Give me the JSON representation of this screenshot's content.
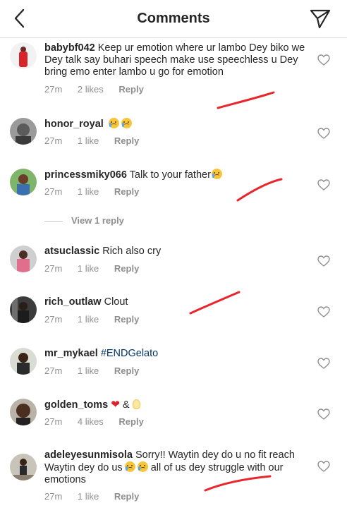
{
  "header": {
    "title": "Comments",
    "back_icon": "chevron-left-icon",
    "send_icon": "paper-plane-icon"
  },
  "comments": [
    {
      "username": "babybf042",
      "text": "Keep ur emotion where ur lambo Dey biko we Dey talk say buhari speech make use speechless u Dey bring emo enter lambo u go for emotion",
      "time": "27m",
      "likes": "2 likes",
      "reply": "Reply"
    },
    {
      "username": "honor_royal",
      "text": "",
      "emoji": [
        "crying-face",
        "crying-face"
      ],
      "time": "27m",
      "likes": "1 like",
      "reply": "Reply"
    },
    {
      "username": "princessmiky066",
      "text": "Talk to your father",
      "emoji": [
        "crying-face"
      ],
      "time": "27m",
      "likes": "1 like",
      "reply": "Reply"
    },
    {
      "username": "atsuclassic",
      "text": "Rich also cry",
      "time": "27m",
      "likes": "1 like",
      "reply": "Reply"
    },
    {
      "username": "rich_outlaw",
      "text": "Clout",
      "time": "27m",
      "likes": "1 like",
      "reply": "Reply"
    },
    {
      "username": "mr_mykael",
      "text": "#ENDGelato",
      "time": "27m",
      "likes": "1 like",
      "reply": "Reply"
    },
    {
      "username": "golden_toms",
      "text": "&",
      "emoji": [
        "red-heart",
        "light-bulb"
      ],
      "time": "27m",
      "likes": "4 likes",
      "reply": "Reply"
    },
    {
      "username": "adeleyesunmisola",
      "text_a": "Sorry!! Waytin dey do u no fit reach Waytin dey do us",
      "text_b": "all of us dey struggle with our emotions",
      "emoji": [
        "loudly-crying-face",
        "loudly-crying-face"
      ],
      "time": "27m",
      "likes": "1 like",
      "reply": "Reply"
    }
  ],
  "view_replies": "View 1 reply",
  "colors": {
    "text": "#262626",
    "muted": "#8e8e8e",
    "hashtag": "#003569",
    "divider": "#dbdbdb",
    "annotation": "#e8262c"
  }
}
